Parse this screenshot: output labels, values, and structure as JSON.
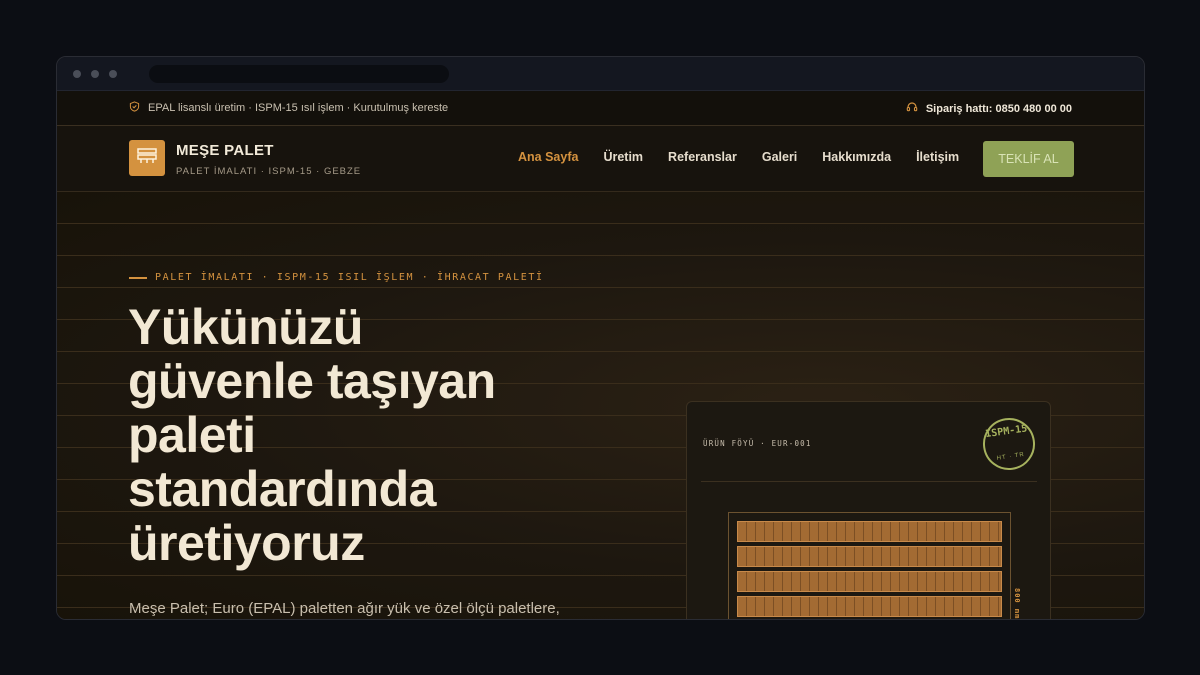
{
  "topbar": {
    "left_text": "EPAL lisanslı üretim · ISPM-15 ısıl işlem · Kurutulmuş kereste",
    "right_text": "Sipariş hattı: 0850 480 00 00"
  },
  "brand": {
    "name": "MEŞE PALET",
    "tagline": "PALET İMALATI · ISPM-15 · GEBZE"
  },
  "nav": {
    "items": [
      "Ana Sayfa",
      "Üretim",
      "Referanslar",
      "Galeri",
      "Hakkımızda",
      "İletişim"
    ],
    "active_index": 0,
    "cta": "TEKLİF AL"
  },
  "hero": {
    "overline": "PALET İMALATI · ISPM-15 ISIL İŞLEM · İHRACAT PALETİ",
    "title_lines": [
      "Yükünüzü",
      "güvenle taşıyan",
      "paleti",
      "standardında",
      "üretiyoruz"
    ],
    "description": "Meşe Palet; Euro (EPAL) paletten ağır yük ve özel ölçü paletlere,"
  },
  "card": {
    "label": "ÜRÜN FÖYÜ · EUR-001",
    "stamp_top": "ISPM-15",
    "stamp_bottom": "HT · TR",
    "dimension": "800 mm"
  },
  "colors": {
    "accent": "#d4923f",
    "cta_bg": "#8fa256",
    "stamp": "#a6b25e",
    "background": "#1a150f"
  }
}
